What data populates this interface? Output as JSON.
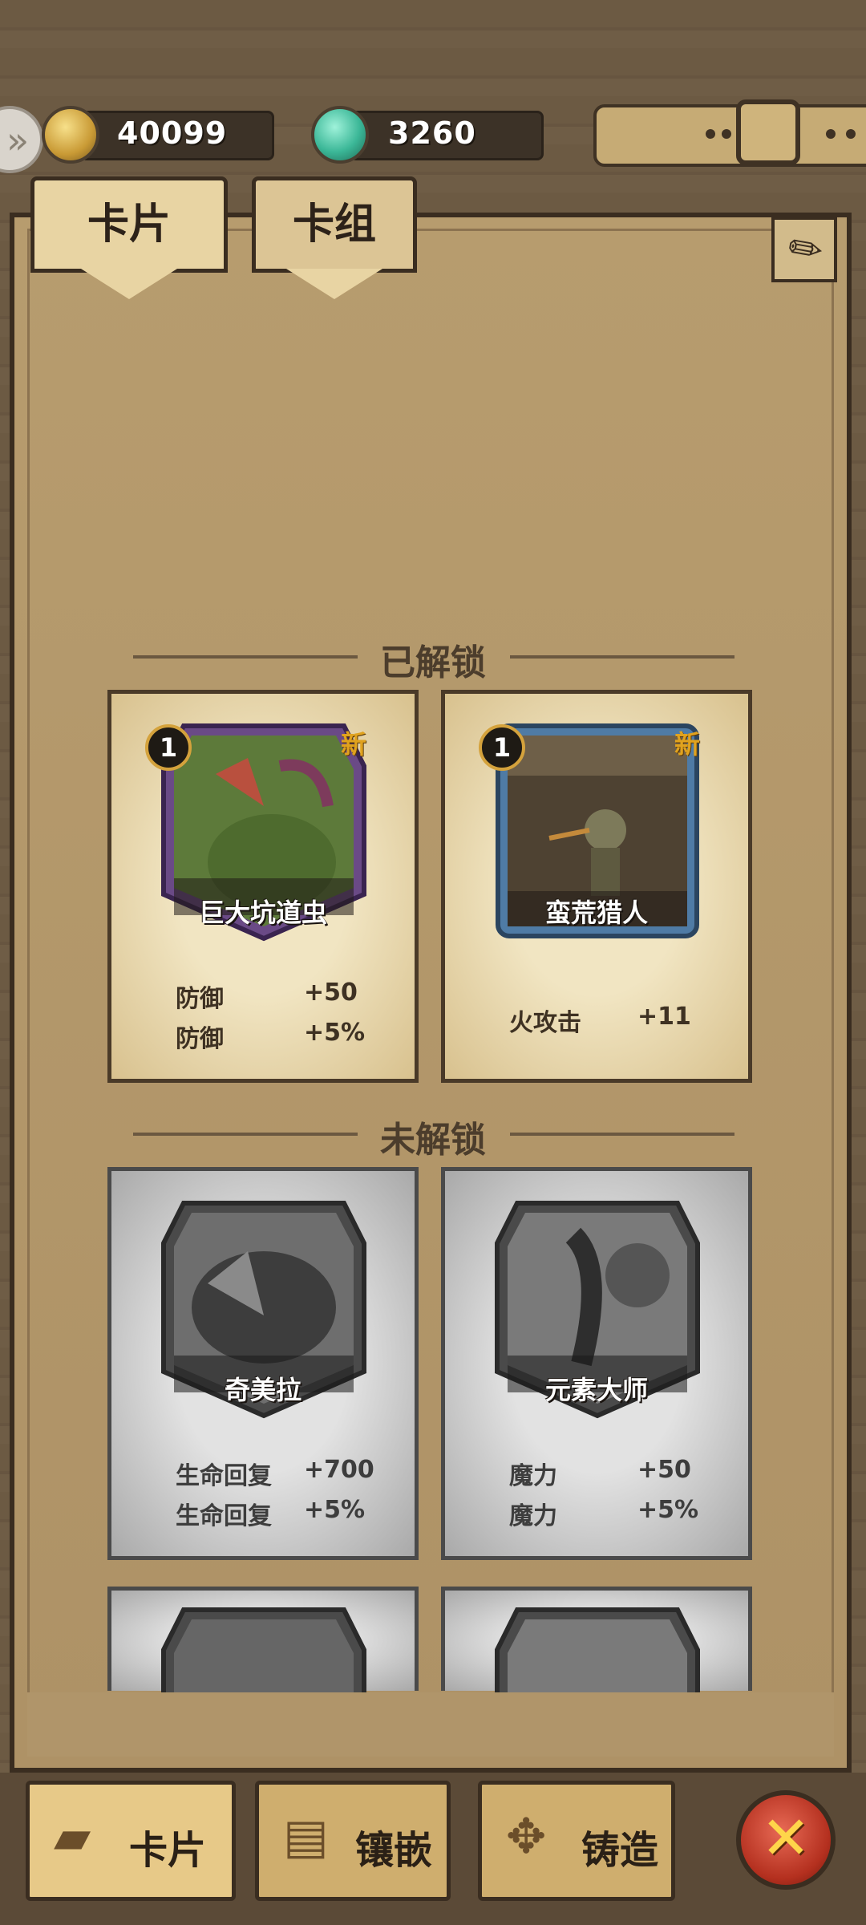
{
  "resources": {
    "gold": "40099",
    "gems": "3260",
    "gold_icon": "gold-nugget-icon",
    "gem_icon": "crystal-gem-icon"
  },
  "tabs": [
    {
      "label": "卡片",
      "active": true
    },
    {
      "label": "卡组",
      "active": false
    }
  ],
  "sections": {
    "unlocked": "已解锁",
    "locked": "未解锁"
  },
  "unlocked_cards": [
    {
      "name": "巨大坑道虫",
      "level": "1",
      "new_label": "新",
      "frame_color": "#7b4bb0",
      "stats": [
        {
          "label": "防御",
          "value": "+50"
        },
        {
          "label": "防御",
          "value": "+5%"
        }
      ]
    },
    {
      "name": "蛮荒猎人",
      "level": "1",
      "new_label": "新",
      "frame_color": "#5a8fc0",
      "stats": [
        {
          "label": "火攻击",
          "value": "+11"
        }
      ]
    }
  ],
  "locked_cards": [
    {
      "name": "奇美拉",
      "stats": [
        {
          "label": "生命回复",
          "value": "+700"
        },
        {
          "label": "生命回复",
          "value": "+5%"
        }
      ]
    },
    {
      "name": "元素大师",
      "stats": [
        {
          "label": "魔力",
          "value": "+50"
        },
        {
          "label": "魔力",
          "value": "+5%"
        }
      ]
    }
  ],
  "bottom_nav": [
    {
      "label": "卡片",
      "icon": "cards-icon",
      "active": true
    },
    {
      "label": "镶嵌",
      "icon": "book-icon",
      "active": false
    },
    {
      "label": "铸造",
      "icon": "forge-icon",
      "active": false
    }
  ],
  "close_icon": "close-x-icon"
}
